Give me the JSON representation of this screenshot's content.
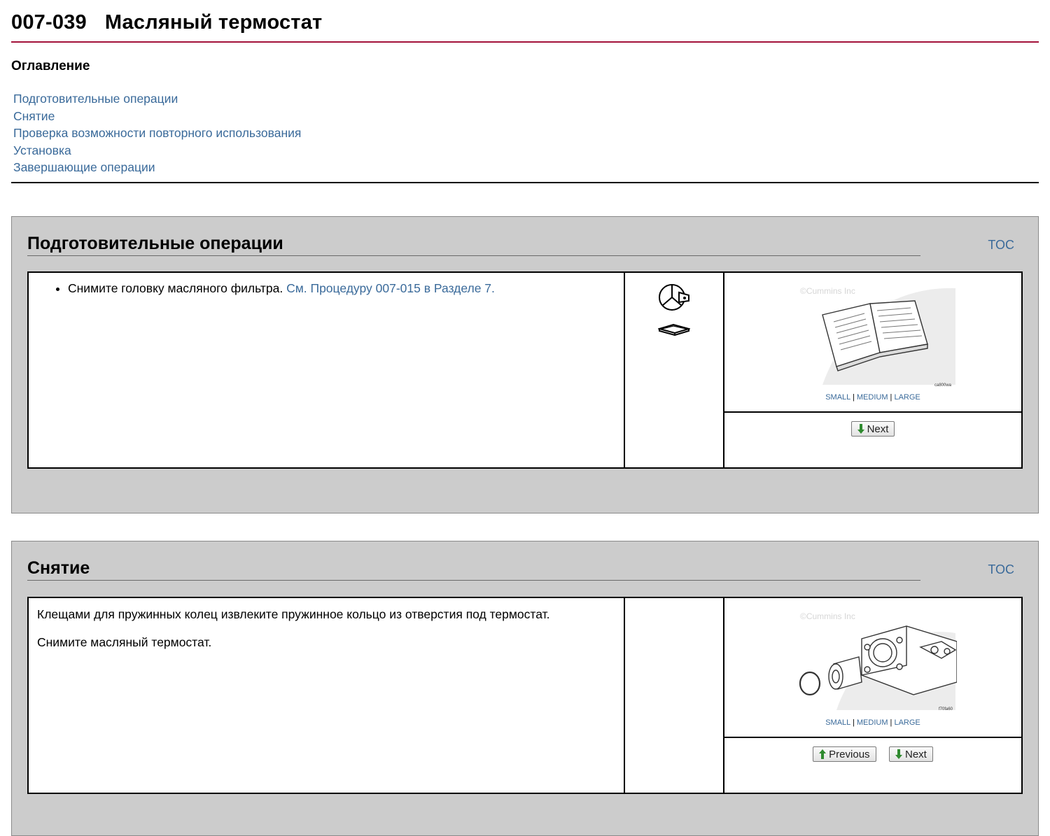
{
  "header": {
    "doc_number": "007-039",
    "doc_title": "Масляный термостат"
  },
  "toc": {
    "heading": "Оглавление",
    "items": [
      "Подготовительные операции",
      "Снятие",
      "Проверка возможности повторного использования",
      "Установка",
      "Завершающие операции"
    ]
  },
  "sections": [
    {
      "title": "Подготовительные операции",
      "toc_label": "TOC",
      "bullet_text": "Снимите головку масляного фильтра.",
      "bullet_link": "См. Процедуру 007-015 в Разделе 7.",
      "icons": [
        "tools-required-icon",
        "reference-manual-icon"
      ],
      "image": {
        "copyright": "©Cummins Inc",
        "code": "ca800wa",
        "sizes": [
          "SMALL",
          "MEDIUM",
          "LARGE"
        ]
      },
      "buttons": {
        "next": "Next"
      }
    },
    {
      "title": "Снятие",
      "toc_label": "TOC",
      "paragraphs": [
        "Клещами для пружинных колец извлеките пружинное кольцо из отверстия под термостат.",
        "Снимите масляный термостат."
      ],
      "image": {
        "copyright": "©Cummins Inc",
        "code": "f70fa60",
        "sizes": [
          "SMALL",
          "MEDIUM",
          "LARGE"
        ]
      },
      "buttons": {
        "previous": "Previous",
        "next": "Next"
      }
    }
  ],
  "colors": {
    "title_rule": "#a3123a",
    "link": "#3a6a9a",
    "section_bg": "#cccccc"
  }
}
